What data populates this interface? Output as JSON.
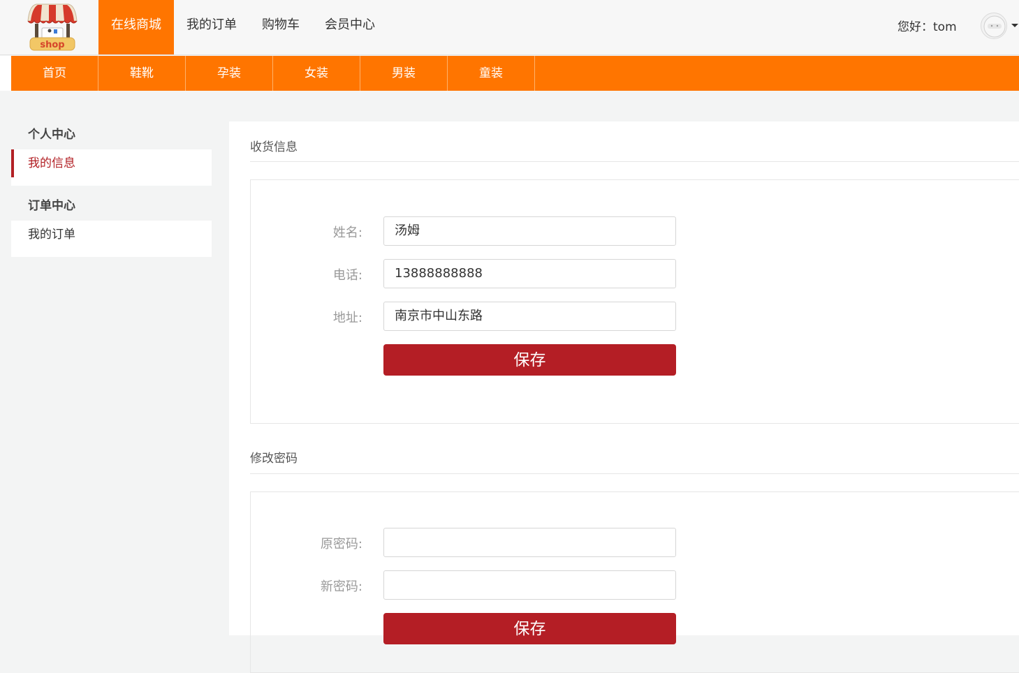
{
  "header": {
    "logo_text": "shop",
    "nav": [
      {
        "label": "在线商城",
        "active": true
      },
      {
        "label": "我的订单",
        "active": false
      },
      {
        "label": "购物车",
        "active": false
      },
      {
        "label": "会员中心",
        "active": false
      }
    ],
    "greeting": "您好：tom"
  },
  "categories": [
    "首页",
    "鞋靴",
    "孕装",
    "女装",
    "男装",
    "童装"
  ],
  "sidebar": {
    "groups": [
      {
        "title": "个人中心",
        "items": [
          {
            "label": "我的信息",
            "active": true
          }
        ]
      },
      {
        "title": "订单中心",
        "items": [
          {
            "label": "我的订单",
            "active": false
          }
        ]
      }
    ]
  },
  "shipping": {
    "title": "收货信息",
    "name_label": "姓名:",
    "name_value": "汤姆",
    "phone_label": "电话:",
    "phone_value": "13888888888",
    "address_label": "地址:",
    "address_value": "南京市中山东路",
    "save_label": "保存"
  },
  "password": {
    "title": "修改密码",
    "old_label": "原密码:",
    "old_value": "",
    "new_label": "新密码:",
    "new_value": "",
    "save_label": "保存"
  },
  "colors": {
    "accent": "#ff7500",
    "primary_button": "#b41e25",
    "active_sidebar": "#b22025"
  }
}
